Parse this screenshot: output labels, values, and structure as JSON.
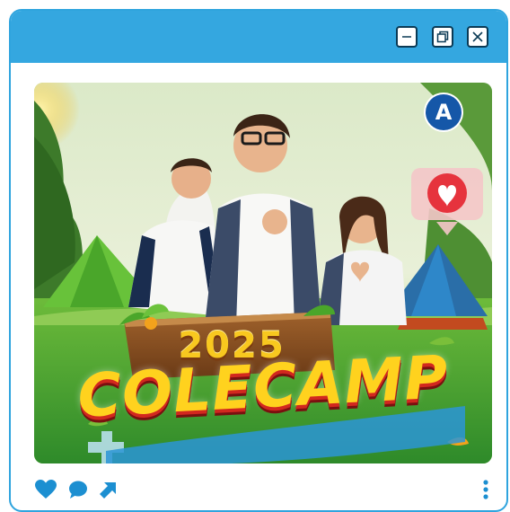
{
  "post": {
    "logo_letter": "A",
    "year": "2025",
    "title": "COLECAMP"
  },
  "window_controls": [
    "minimize-icon",
    "restore-icon",
    "close-icon"
  ],
  "actions": [
    "heart-icon",
    "comment-icon",
    "share-arrow-icon",
    "more-vertical-icon"
  ],
  "colors": {
    "titlebar": "#34a7e0",
    "accent": "#1c8fd1",
    "title_yellow": "#ffd21e",
    "title_red": "#d2281f"
  }
}
